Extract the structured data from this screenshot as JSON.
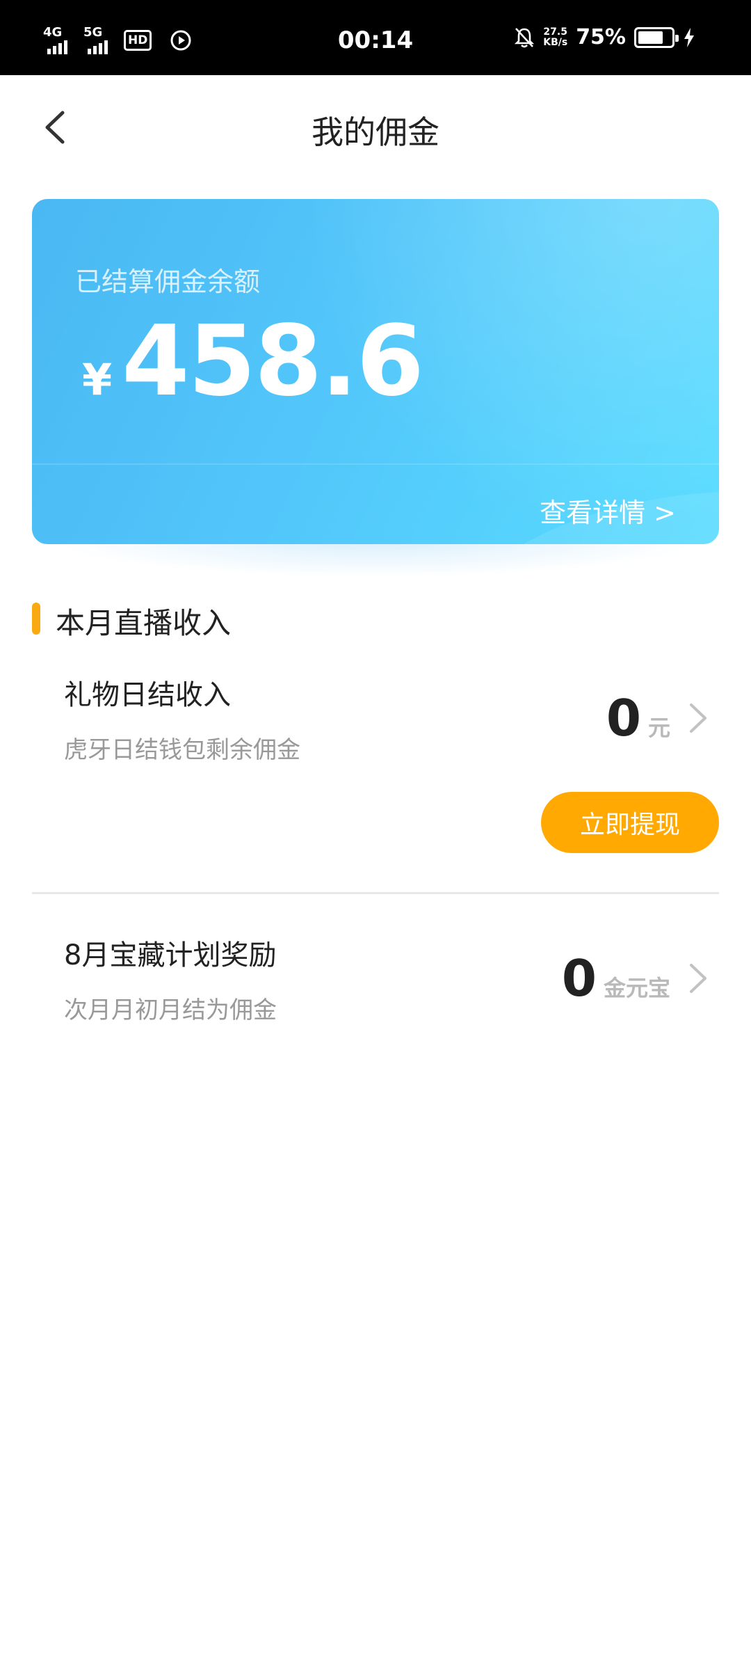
{
  "status_bar": {
    "net1": "4G",
    "net2": "5G",
    "hd": "HD",
    "hd_sub": "1\n2",
    "time": "00:14",
    "speed_value": "27.5",
    "speed_unit": "KB/s",
    "battery_pct": "75%",
    "battery_level": 0.75,
    "icons": [
      "signal-icon",
      "play-icon",
      "alarm-off-icon",
      "battery-icon",
      "charging-icon"
    ]
  },
  "header": {
    "title": "我的佣金"
  },
  "balance_card": {
    "label": "已结算佣金余额",
    "currency": "¥",
    "amount": "458.6",
    "detail_link": "查看详情 >",
    "colors": {
      "gradient_start": "#4ab8f3",
      "gradient_end": "#58dcff"
    }
  },
  "section": {
    "title": "本月直播收入",
    "accent": "#f9a911"
  },
  "rows": [
    {
      "title": "礼物日结收入",
      "subtitle": "虎牙日结钱包剩余佣金",
      "value": "0",
      "unit": "元"
    },
    {
      "title": "8月宝藏计划奖励",
      "subtitle": "次月月初月结为佣金",
      "value": "0",
      "unit": "金元宝"
    }
  ],
  "withdraw_button": {
    "label": "立即提现",
    "color": "#ffa902"
  }
}
